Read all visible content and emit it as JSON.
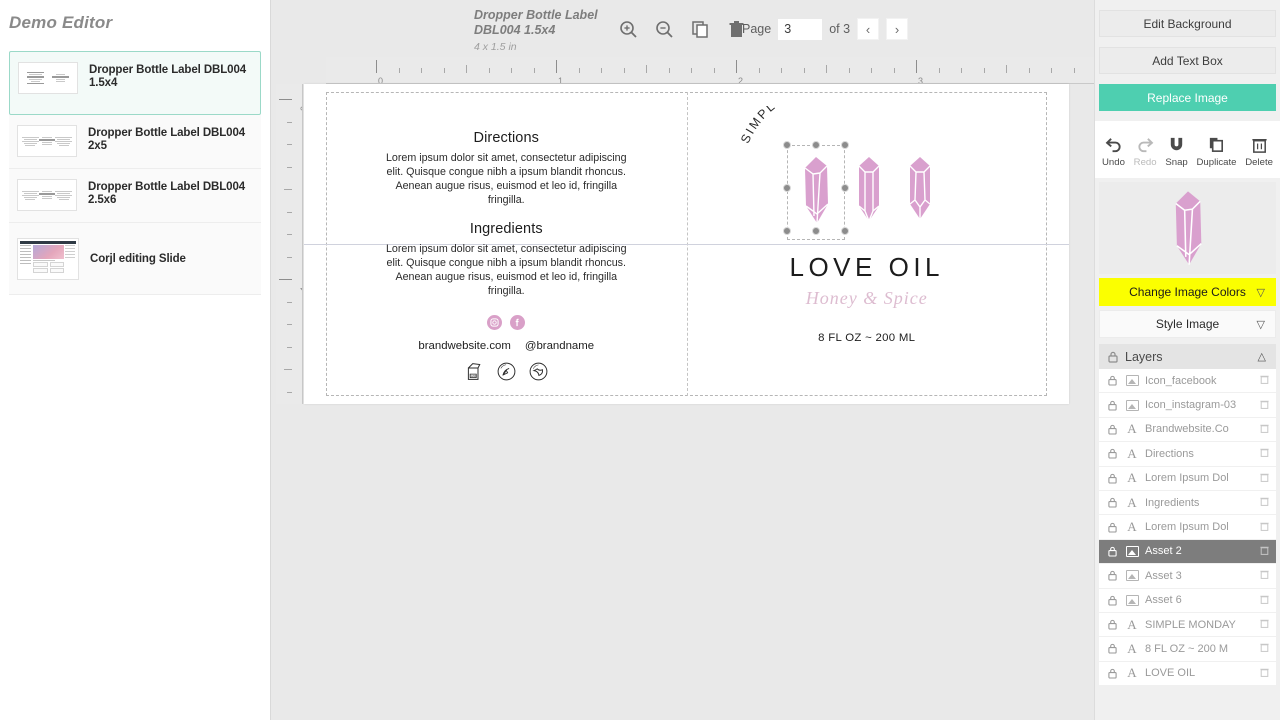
{
  "left_sidebar": {
    "title": "Demo Editor",
    "pages": [
      {
        "label": "Dropper Bottle Label DBL004 1.5x4",
        "selected": true,
        "thumb": "label-3col"
      },
      {
        "label": "Dropper Bottle Label DBL004 2x5",
        "selected": false,
        "thumb": "label-3col"
      },
      {
        "label": "Dropper Bottle Label DBL004 2.5x6",
        "selected": false,
        "thumb": "label-3col"
      },
      {
        "label": "Corjl editing Slide",
        "selected": false,
        "thumb": "screenshot"
      }
    ]
  },
  "toolbar": {
    "doc_title": "Dropper Bottle Label DBL004 1.5x4",
    "doc_dims": "4 x 1.5 in",
    "zoom_in_icon": "magnifier-plus-icon",
    "zoom_out_icon": "magnifier-minus-icon",
    "copy_icon": "copy-page-icon",
    "trash_icon": "delete-page-icon",
    "page_label": "Page",
    "page_value": "3",
    "page_of": "of 3",
    "prev_label": "‹",
    "next_label": "›"
  },
  "rulers": {
    "horizontal_labels": [
      "0",
      "1",
      "2",
      "3"
    ],
    "vertical_labels": [
      "0",
      "1"
    ],
    "unit": "in"
  },
  "label_design": {
    "left_panel": {
      "directions_heading": "Directions",
      "directions_body": "Lorem ipsum dolor sit amet, consectetur adipiscing elit. Quisque congue nibh a ipsum blandit rhoncus. Aenean augue risus, euismod et leo id, fringilla fringilla.",
      "ingredients_heading": "Ingredients",
      "ingredients_body": "Lorem ipsum dolor sit amet, consectetur adipiscing elit. Quisque congue nibh a ipsum blandit rhoncus. Aenean augue risus, euismod et leo id, fringilla fringilla.",
      "website": "brandwebsite.com",
      "handle": "@brandname",
      "social": [
        "instagram-icon",
        "facebook-icon"
      ],
      "certifications": [
        "pao-12m-icon",
        "cruelty-free-icon",
        "vegan-icon"
      ]
    },
    "right_panel": {
      "arc_text": "SIMPLE MONDAY",
      "product_name": "LOVE OIL",
      "tagline": "Honey & Spice",
      "volume": "8 FL OZ ~ 200 ML",
      "crystal_count": 3,
      "crystal_color": "#d9a0ce",
      "selected_crystal_index": 0
    }
  },
  "right_sidebar": {
    "edit_background": "Edit Background",
    "add_text_box": "Add Text Box",
    "replace_image": "Replace Image",
    "replace_image_color": "#4ecfb0",
    "tools": [
      {
        "label": "Undo",
        "icon": "undo-icon",
        "disabled": false
      },
      {
        "label": "Redo",
        "icon": "redo-icon",
        "disabled": true
      },
      {
        "label": "Snap",
        "icon": "magnet-icon",
        "disabled": false
      },
      {
        "label": "Duplicate",
        "icon": "duplicate-icon",
        "disabled": false
      },
      {
        "label": "Delete",
        "icon": "trash-icon",
        "disabled": false
      }
    ],
    "change_image_colors": "Change Image Colors",
    "change_image_colors_color": "#fbff00",
    "style_image": "Style Image",
    "layers_title": "Layers",
    "layers": [
      {
        "name": "Icon_facebook",
        "type": "image",
        "active": false
      },
      {
        "name": "Icon_instagram-03",
        "type": "image",
        "active": false
      },
      {
        "name": "Brandwebsite.Co",
        "type": "text",
        "active": false
      },
      {
        "name": "Directions",
        "type": "text",
        "active": false
      },
      {
        "name": "Lorem Ipsum Dol",
        "type": "text",
        "active": false
      },
      {
        "name": "Ingredients",
        "type": "text",
        "active": false
      },
      {
        "name": "Lorem Ipsum Dol",
        "type": "text",
        "active": false
      },
      {
        "name": "Asset 2",
        "type": "image",
        "active": true
      },
      {
        "name": "Asset 3",
        "type": "image",
        "active": false
      },
      {
        "name": "Asset 6",
        "type": "image",
        "active": false
      },
      {
        "name": "SIMPLE MONDAY",
        "type": "text",
        "active": false
      },
      {
        "name": "8 FL OZ ~ 200 M",
        "type": "text",
        "active": false
      },
      {
        "name": "LOVE OIL",
        "type": "text",
        "active": false
      }
    ]
  }
}
